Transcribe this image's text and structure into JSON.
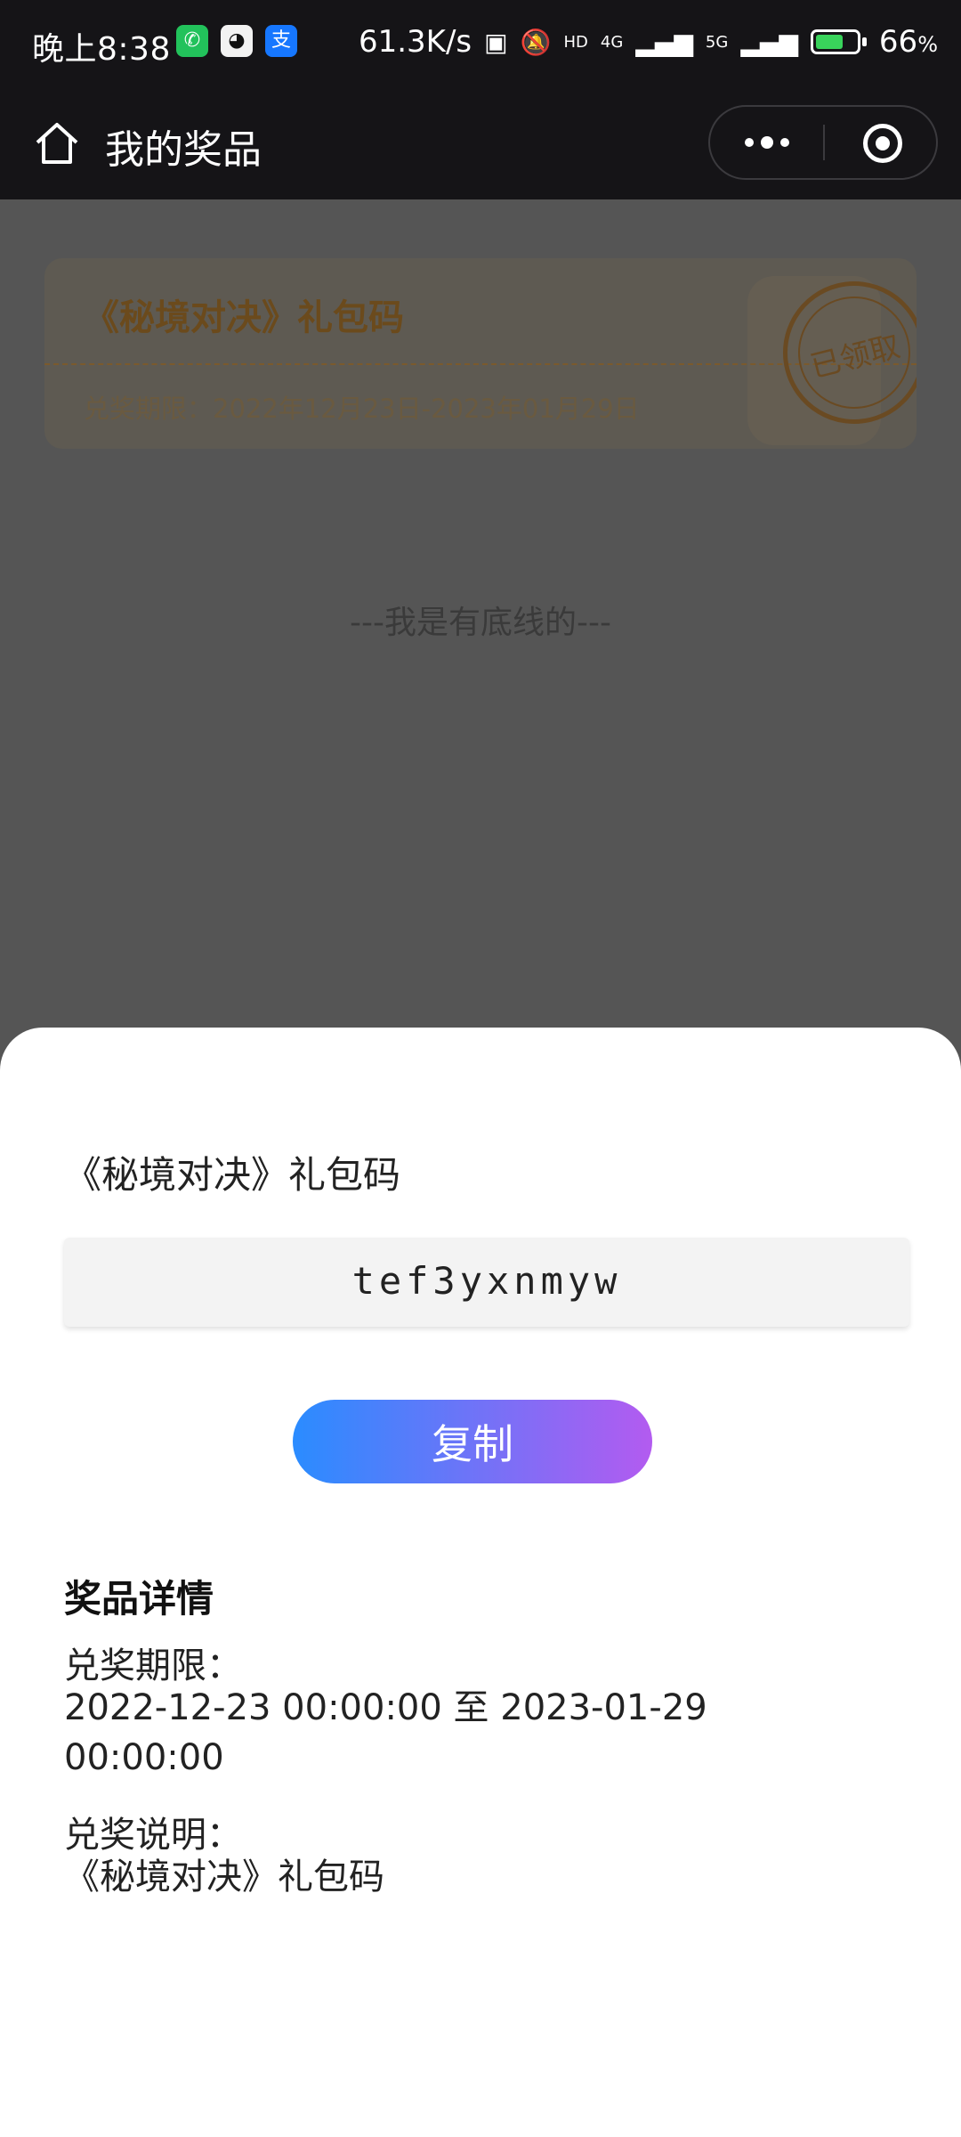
{
  "status_bar": {
    "time": "晚上8:38",
    "net_speed": "61.3K/s",
    "signal_1": "4G",
    "signal_2": "5G",
    "hd_label": "HD",
    "battery_percent": "66",
    "battery_suffix": "%",
    "notification_apps": [
      "wechat-icon",
      "qq-icon",
      "alipay-icon"
    ]
  },
  "nav": {
    "title": "我的奖品",
    "icons": [
      "home-icon",
      "more-icon",
      "close-miniprogram-icon"
    ]
  },
  "background_list": {
    "card": {
      "title": "《秘境对决》礼包码",
      "period": "兑奖期限：2022年12月23日-2023年01月29日",
      "stamp": "已领取"
    },
    "end_text": "---我是有底线的---"
  },
  "sheet": {
    "title": "《秘境对决》礼包码",
    "code": "tef3yxnmyw",
    "copy_label": "复制",
    "detail_heading": "奖品详情",
    "period_label": "兑奖期限：",
    "period_value": "2022-12-23 00:00:00 至 2023-01-29 00:00:00",
    "desc_label": "兑奖说明：",
    "desc_value": "《秘境对决》礼包码"
  },
  "colors": {
    "header_bg": "#151417",
    "overlay_bg": "#555555",
    "button_gradient_start": "#2a8cff",
    "button_gradient_end": "#b35bf0"
  }
}
